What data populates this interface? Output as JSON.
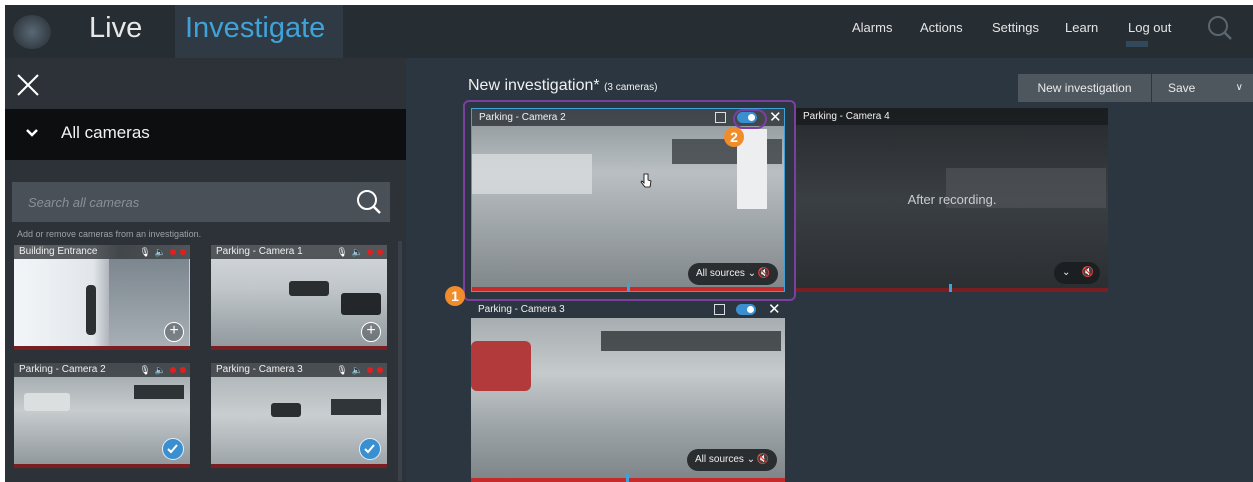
{
  "topbar": {
    "tabs": [
      {
        "label": "Live"
      },
      {
        "label": "Investigate"
      }
    ],
    "nav": [
      {
        "label": "Alarms"
      },
      {
        "label": "Actions"
      },
      {
        "label": "Settings"
      },
      {
        "label": "Learn"
      },
      {
        "label": "Log out"
      }
    ]
  },
  "left_panel": {
    "group_label": "All cameras",
    "search_placeholder": "Search all cameras",
    "hint": "Add or remove cameras from an investigation.",
    "cameras": [
      {
        "name": "Building Entrance",
        "action": "add"
      },
      {
        "name": "Parking - Camera 1",
        "action": "add"
      },
      {
        "name": "Parking - Camera 2",
        "action": "added"
      },
      {
        "name": "Parking - Camera 3",
        "action": "added"
      }
    ]
  },
  "investigation": {
    "title": "New investigation*",
    "camera_count": "(3 cameras)",
    "buttons": {
      "new": "New investigation",
      "save": "Save"
    },
    "views": [
      {
        "camera": "Parking - Camera 2",
        "sources": "All sources",
        "overlay": ""
      },
      {
        "camera": "Parking - Camera 4",
        "sources": "",
        "overlay": "After recording."
      },
      {
        "camera": "Parking - Camera 3",
        "sources": "All sources",
        "overlay": ""
      }
    ]
  },
  "callouts": [
    "1",
    "2"
  ],
  "colors": {
    "accent": "#3fa3d9",
    "callout": "#f08c2a",
    "highlight": "#7b3fa0",
    "timeline": "#c62a2a"
  }
}
